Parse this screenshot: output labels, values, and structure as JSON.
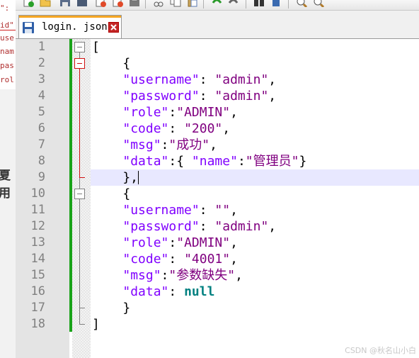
{
  "background_app": {
    "lines": [
      "\":",
      "id\"",
      "use",
      "nam",
      "pas",
      "rol"
    ],
    "bold_text": "夏用"
  },
  "toolbar": {
    "icons": [
      "new-file-icon",
      "open-file-icon",
      "save-icon",
      "save-all-icon",
      "close-icon",
      "close-all-icon",
      "print-icon",
      "cut-icon",
      "copy-icon",
      "paste-icon",
      "undo-icon",
      "redo-icon",
      "find-icon",
      "replace-icon",
      "zoom-in-icon",
      "zoom-out-icon"
    ]
  },
  "tab": {
    "title": "login. json",
    "accent_color": "#f5a623"
  },
  "editor": {
    "current_line": 9,
    "lines": [
      {
        "n": "1",
        "tokens": [
          {
            "t": "[",
            "c": "p"
          }
        ]
      },
      {
        "n": "2",
        "tokens": [
          {
            "t": "    {",
            "c": "p"
          }
        ]
      },
      {
        "n": "3",
        "tokens": [
          {
            "t": "    ",
            "c": "p"
          },
          {
            "t": "\"username\"",
            "c": "k"
          },
          {
            "t": ": ",
            "c": "p"
          },
          {
            "t": "\"admin\"",
            "c": "s"
          },
          {
            "t": ",",
            "c": "p"
          }
        ]
      },
      {
        "n": "4",
        "tokens": [
          {
            "t": "    ",
            "c": "p"
          },
          {
            "t": "\"password\"",
            "c": "k"
          },
          {
            "t": ": ",
            "c": "p"
          },
          {
            "t": "\"admin\"",
            "c": "s"
          },
          {
            "t": ",",
            "c": "p"
          }
        ]
      },
      {
        "n": "5",
        "tokens": [
          {
            "t": "    ",
            "c": "p"
          },
          {
            "t": "\"role\"",
            "c": "k"
          },
          {
            "t": ":",
            "c": "p"
          },
          {
            "t": "\"ADMIN\"",
            "c": "s"
          },
          {
            "t": ",",
            "c": "p"
          }
        ]
      },
      {
        "n": "6",
        "tokens": [
          {
            "t": "    ",
            "c": "p"
          },
          {
            "t": "\"code\"",
            "c": "k"
          },
          {
            "t": ": ",
            "c": "p"
          },
          {
            "t": "\"200\"",
            "c": "s"
          },
          {
            "t": ",",
            "c": "p"
          }
        ]
      },
      {
        "n": "7",
        "tokens": [
          {
            "t": "    ",
            "c": "p"
          },
          {
            "t": "\"msg\"",
            "c": "k"
          },
          {
            "t": ":",
            "c": "p"
          },
          {
            "t": "\"成功\"",
            "c": "s"
          },
          {
            "t": ",",
            "c": "p"
          }
        ]
      },
      {
        "n": "8",
        "tokens": [
          {
            "t": "    ",
            "c": "p"
          },
          {
            "t": "\"data\"",
            "c": "k"
          },
          {
            "t": ":{ ",
            "c": "p"
          },
          {
            "t": "\"name\"",
            "c": "k"
          },
          {
            "t": ":",
            "c": "p"
          },
          {
            "t": "\"管理员\"",
            "c": "s"
          },
          {
            "t": "}",
            "c": "p"
          }
        ]
      },
      {
        "n": "9",
        "tokens": [
          {
            "t": "    },",
            "c": "p"
          }
        ]
      },
      {
        "n": "10",
        "tokens": [
          {
            "t": "    {",
            "c": "p"
          }
        ]
      },
      {
        "n": "11",
        "tokens": [
          {
            "t": "    ",
            "c": "p"
          },
          {
            "t": "\"username\"",
            "c": "k"
          },
          {
            "t": ": ",
            "c": "p"
          },
          {
            "t": "\"\"",
            "c": "s"
          },
          {
            "t": ",",
            "c": "p"
          }
        ]
      },
      {
        "n": "12",
        "tokens": [
          {
            "t": "    ",
            "c": "p"
          },
          {
            "t": "\"password\"",
            "c": "k"
          },
          {
            "t": ": ",
            "c": "p"
          },
          {
            "t": "\"admin\"",
            "c": "s"
          },
          {
            "t": ",",
            "c": "p"
          }
        ]
      },
      {
        "n": "13",
        "tokens": [
          {
            "t": "    ",
            "c": "p"
          },
          {
            "t": "\"role\"",
            "c": "k"
          },
          {
            "t": ":",
            "c": "p"
          },
          {
            "t": "\"ADMIN\"",
            "c": "s"
          },
          {
            "t": ",",
            "c": "p"
          }
        ]
      },
      {
        "n": "14",
        "tokens": [
          {
            "t": "    ",
            "c": "p"
          },
          {
            "t": "\"code\"",
            "c": "k"
          },
          {
            "t": ": ",
            "c": "p"
          },
          {
            "t": "\"4001\"",
            "c": "s"
          },
          {
            "t": ",",
            "c": "p"
          }
        ]
      },
      {
        "n": "15",
        "tokens": [
          {
            "t": "    ",
            "c": "p"
          },
          {
            "t": "\"msg\"",
            "c": "k"
          },
          {
            "t": ":",
            "c": "p"
          },
          {
            "t": "\"参数缺失\"",
            "c": "s"
          },
          {
            "t": ",",
            "c": "p"
          }
        ]
      },
      {
        "n": "16",
        "tokens": [
          {
            "t": "    ",
            "c": "p"
          },
          {
            "t": "\"data\"",
            "c": "k"
          },
          {
            "t": ": ",
            "c": "p"
          },
          {
            "t": "null",
            "c": "n"
          }
        ]
      },
      {
        "n": "17",
        "tokens": [
          {
            "t": "    }",
            "c": "p"
          }
        ]
      },
      {
        "n": "18",
        "tokens": [
          {
            "t": "]",
            "c": "p"
          }
        ]
      }
    ]
  },
  "watermark": "CSDN @秋名山小白"
}
